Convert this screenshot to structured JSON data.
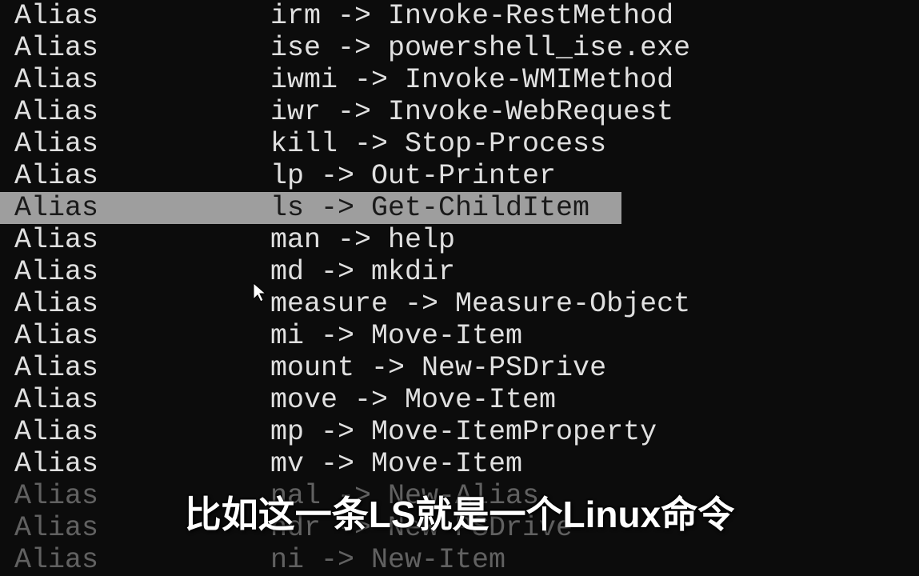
{
  "rows": [
    {
      "type": "Alias",
      "mapping": "irm -> Invoke-RestMethod",
      "highlighted": false
    },
    {
      "type": "Alias",
      "mapping": "ise -> powershell_ise.exe",
      "highlighted": false
    },
    {
      "type": "Alias",
      "mapping": "iwmi -> Invoke-WMIMethod",
      "highlighted": false
    },
    {
      "type": "Alias",
      "mapping": "iwr -> Invoke-WebRequest",
      "highlighted": false
    },
    {
      "type": "Alias",
      "mapping": "kill -> Stop-Process",
      "highlighted": false
    },
    {
      "type": "Alias",
      "mapping": "lp -> Out-Printer",
      "highlighted": false
    },
    {
      "type": "Alias",
      "mapping": "ls -> Get-ChildItem",
      "highlighted": true
    },
    {
      "type": "Alias",
      "mapping": "man -> help",
      "highlighted": false
    },
    {
      "type": "Alias",
      "mapping": "md -> mkdir",
      "highlighted": false
    },
    {
      "type": "Alias",
      "mapping": "measure -> Measure-Object",
      "highlighted": false
    },
    {
      "type": "Alias",
      "mapping": "mi -> Move-Item",
      "highlighted": false
    },
    {
      "type": "Alias",
      "mapping": "mount -> New-PSDrive",
      "highlighted": false
    },
    {
      "type": "Alias",
      "mapping": "move -> Move-Item",
      "highlighted": false
    },
    {
      "type": "Alias",
      "mapping": "mp -> Move-ItemProperty",
      "highlighted": false
    },
    {
      "type": "Alias",
      "mapping": "mv -> Move-Item",
      "highlighted": false
    },
    {
      "type": "Alias",
      "mapping": "nal -> New-Alias",
      "highlighted": false,
      "faded": true
    },
    {
      "type": "Alias",
      "mapping": "ndr -> New-PSDrive",
      "highlighted": false,
      "faded": true
    },
    {
      "type": "Alias",
      "mapping": "ni -> New-Item",
      "highlighted": false,
      "faded": true
    }
  ],
  "subtitle": "比如这一条LS就是一个Linux命令",
  "cursor_glyph": "▲"
}
